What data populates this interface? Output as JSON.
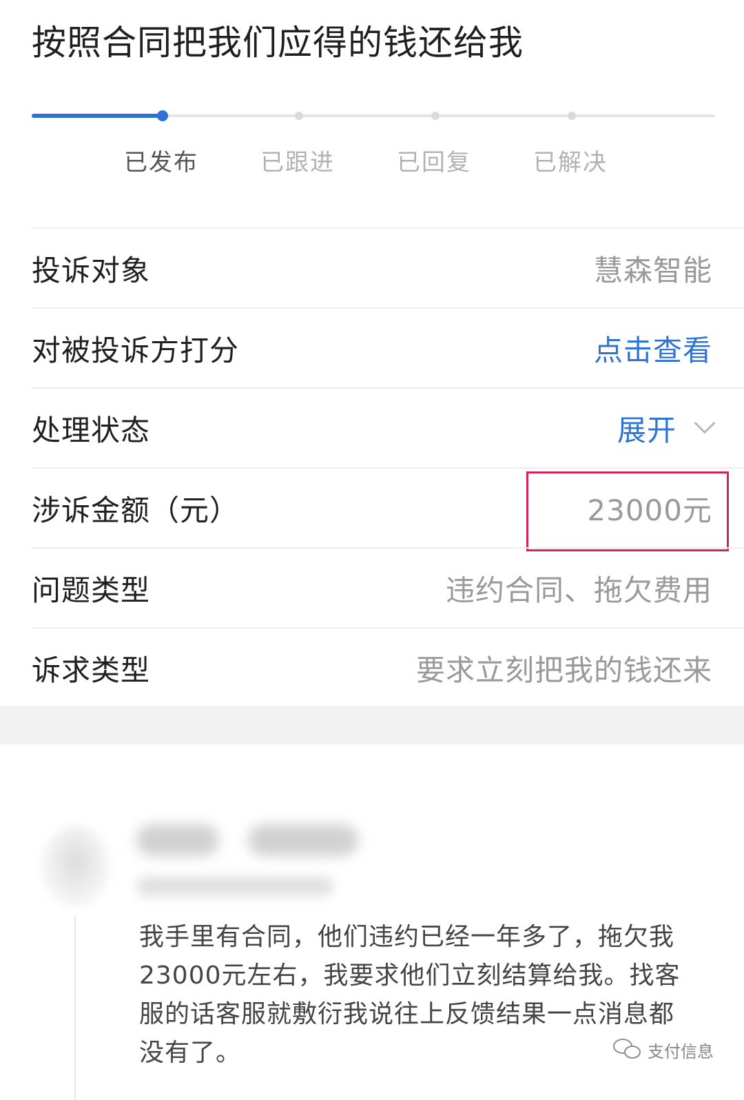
{
  "title": "按照合同把我们应得的钱还给我",
  "progress": {
    "current_step": 1,
    "steps": [
      "已发布",
      "已跟进",
      "已回复",
      "已解决"
    ]
  },
  "rows": [
    {
      "label": "投诉对象",
      "value": "慧森智能"
    },
    {
      "label": "对被投诉方打分",
      "value": "点击查看"
    },
    {
      "label": "处理状态",
      "value": "展开"
    },
    {
      "label": "涉诉金额（元）",
      "value": "23000元"
    },
    {
      "label": "问题类型",
      "value": "违约合同、拖欠费用"
    },
    {
      "label": "诉求类型",
      "value": "要求立刻把我的钱还来"
    }
  ],
  "comment": {
    "text": "我手里有合同，他们违约已经一年多了，拖欠我23000元左右，我要求他们立刻结算给我。找客服的话客服就敷衍我说往上反馈结果一点消息都没有了。"
  },
  "watermark": {
    "icon": "wechat-icon",
    "text": "支付信息"
  },
  "colors": {
    "accent": "#2f6fd6",
    "link": "#2f74d0",
    "highlight_border": "#d2245a"
  }
}
